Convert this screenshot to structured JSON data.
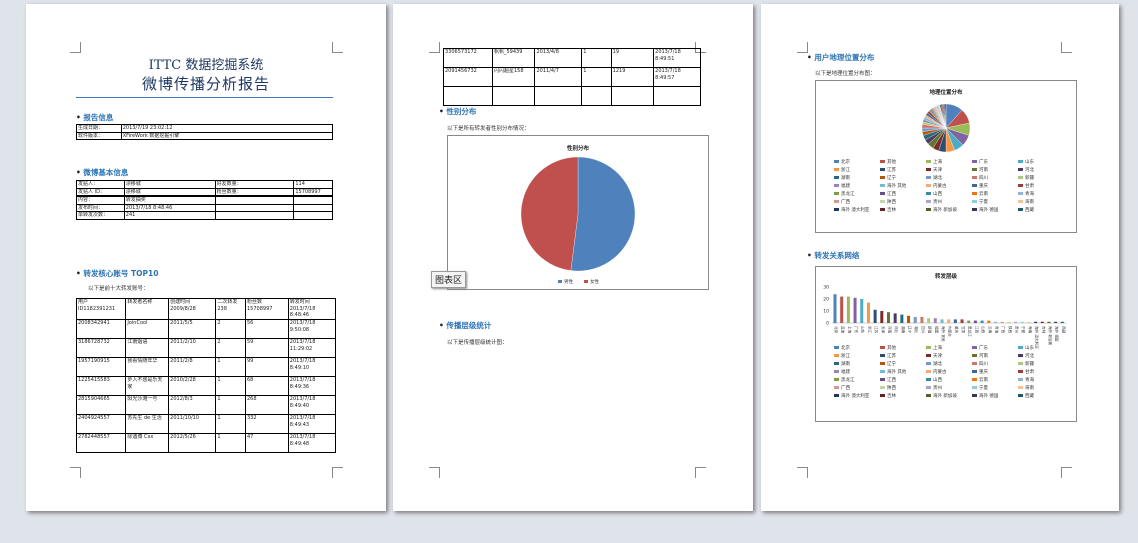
{
  "page1": {
    "title": "ITTC 数据挖掘系统",
    "subtitle": "微博传播分析报告",
    "sec_report": "报告信息",
    "report_rows": [
      [
        "生成日期：",
        "2013/7/19 23:02:12"
      ],
      [
        "软件版本：",
        "XFireWork 数据挖掘引擎"
      ]
    ],
    "sec_weibo": "微博基本信息",
    "weibo_rows": [
      [
        "发贴人：",
        "漂移城",
        "好友数量：",
        "114"
      ],
      [
        "发贴人 ID：",
        "漂移城",
        "粉丝数量：",
        "15708997"
      ],
      [
        "",
        "",
        "",
        ""
      ],
      [
        "内容：",
        "转发抽奖",
        "",
        ""
      ],
      [
        "发布时间：",
        "2013/7/18 8:48:46",
        "",
        ""
      ],
      [
        "单转发次数：",
        "241",
        "",
        ""
      ]
    ],
    "sec_top": "转发核心账号 TOP10",
    "top_intro": "以下是前十大转发账号：",
    "top_header": [
      "用户 ID1182391231",
      "转发者名称",
      "创建时间 2009/8/28",
      "二次转发 238",
      "粉丝数 15708997",
      "转发时间 2013/7/18 8:48:46"
    ],
    "top_rows": [
      [
        "2008342941",
        "JoinCool",
        "2011/5/5",
        "2",
        "56",
        "2013/7/18 9:50:08"
      ],
      [
        "3186728732",
        "江南烟语",
        "2011/2/10",
        "2",
        "59",
        "2013/7/18 11:29:02"
      ],
      [
        "1957190915",
        "我看情随年华",
        "2011/2/8",
        "1",
        "99",
        "2013/7/18 8:49:10"
      ],
      [
        "1225415583",
        "步入不惑是乐天家",
        "2010/2/28",
        "1",
        "68",
        "2013/7/18 8:49:36"
      ],
      [
        "2815904665",
        "阳光沙滩一号",
        "2012/8/3",
        "1",
        "268",
        "2013/7/18 8:49:40"
      ],
      [
        "2404924557",
        "苏先生 de 生活",
        "2011/10/10",
        "1",
        "332",
        "2013/7/18 8:49:43"
      ],
      [
        "2782448557",
        "际遇博 Cxx",
        "2012/5/26",
        "1",
        "47",
        "2013/7/18 8:49:48"
      ]
    ]
  },
  "page2": {
    "rows": [
      [
        "3306573172",
        "帆帆_59439",
        "2013/4/8",
        "1",
        "19",
        "2013/7/18 8:49:51"
      ],
      [
        "2091456732",
        "闪闪超星158",
        "2011/4/7",
        "1",
        "1219",
        "2013/7/18 8:49:57"
      ],
      [
        "",
        "",
        "",
        "",
        "",
        ""
      ]
    ],
    "sec_gender": "性别分布",
    "gender_intro": "以下是所有转发者性别分布情况：",
    "sec_level": "传播层级统计",
    "level_intro": "以下是传播层级统计图：",
    "chart_tag": "图表区"
  },
  "page3": {
    "sec_geo": "用户地理位置分布",
    "geo_intro": "以下是地理位置分布图：",
    "sec_network": "转发关系网络",
    "provinces": [
      "北京",
      "其他",
      "上海",
      "广东",
      "山东",
      "浙江",
      "江苏",
      "天津",
      "河南",
      "河北",
      "湖南",
      "辽宁",
      "湖北",
      "四川",
      "新疆",
      "福建",
      "海外 其他",
      "内蒙古",
      "重庆",
      "甘肃",
      "黑龙江",
      "江西",
      "山西",
      "云南",
      "青海",
      "广西",
      "陕西",
      "贵州",
      "宁夏",
      "海南",
      "海外 澳大利亚",
      "吉林",
      "海外 新加坡",
      "海外 德国",
      "西藏"
    ],
    "colors": [
      "#4f81bd",
      "#c0504d",
      "#9bbb59",
      "#8064a2",
      "#4bacc6",
      "#f79646",
      "#2c4d75",
      "#772c2a",
      "#5f7530",
      "#4d3b62",
      "#276a7c",
      "#b65708",
      "#729aca",
      "#cd7371",
      "#afc97a",
      "#9983b5",
      "#6fbdd1",
      "#f9ab6b",
      "#3a679c",
      "#9f3b38",
      "#7e9c40",
      "#664f83",
      "#358ea6",
      "#f3740b",
      "#95b3d7",
      "#d99694",
      "#c3d69b",
      "#b2a1c7",
      "#93cddd",
      "#fac090",
      "#1f3864",
      "#632523",
      "#4f6228",
      "#3f3151",
      "#215968"
    ]
  },
  "chart_data": [
    {
      "type": "pie",
      "title": "性别分布",
      "categories": [
        "男性",
        "女性"
      ],
      "values": [
        52,
        48
      ],
      "colors": [
        "#4f81bd",
        "#c0504d"
      ]
    },
    {
      "type": "pie",
      "title": "地理位置分布",
      "categories": [
        "北京",
        "其他",
        "上海",
        "广东",
        "山东",
        "浙江",
        "江苏",
        "天津",
        "河南",
        "河北",
        "湖南",
        "辽宁",
        "湖北",
        "四川",
        "新疆",
        "福建",
        "海外 其他",
        "内蒙古",
        "重庆",
        "甘肃",
        "黑龙江",
        "江西",
        "山西",
        "云南",
        "青海",
        "广西",
        "陕西",
        "贵州",
        "宁夏",
        "海南",
        "海外 澳大利亚",
        "吉林",
        "海外 新加坡",
        "海外 德国",
        "西藏"
      ],
      "values": [
        14,
        12,
        10,
        9,
        8,
        7,
        6,
        5,
        5,
        4,
        4,
        3,
        3,
        3,
        2,
        2,
        2,
        2,
        2,
        2,
        1,
        1,
        1,
        1,
        1,
        1,
        1,
        1,
        1,
        1,
        1,
        1,
        1,
        1,
        1
      ]
    },
    {
      "type": "bar",
      "title": "转发层级",
      "ylim": [
        0,
        30
      ],
      "yticks": [
        0,
        10,
        20,
        30
      ],
      "categories": [
        "北京",
        "其他",
        "上海",
        "广东",
        "山东",
        "浙江",
        "江苏",
        "天津",
        "河南",
        "河北",
        "湖南",
        "辽宁",
        "湖北",
        "四川",
        "新疆",
        "福建",
        "海外 其他",
        "内蒙古",
        "重庆",
        "甘肃",
        "黑龙江",
        "江西",
        "山西",
        "云南",
        "青海",
        "广西",
        "陕西",
        "贵州",
        "宁夏",
        "海南",
        "海外 澳大利亚",
        "吉林",
        "海外 新加坡",
        "海外 德国",
        "西藏"
      ],
      "values": [
        24,
        22,
        22,
        21,
        20,
        17,
        11,
        10,
        9,
        8,
        7,
        6,
        5,
        5,
        4,
        4,
        3,
        3,
        3,
        3,
        2,
        2,
        2,
        2,
        1,
        1,
        1,
        1,
        1,
        1,
        1,
        1,
        1,
        1,
        1
      ]
    }
  ]
}
